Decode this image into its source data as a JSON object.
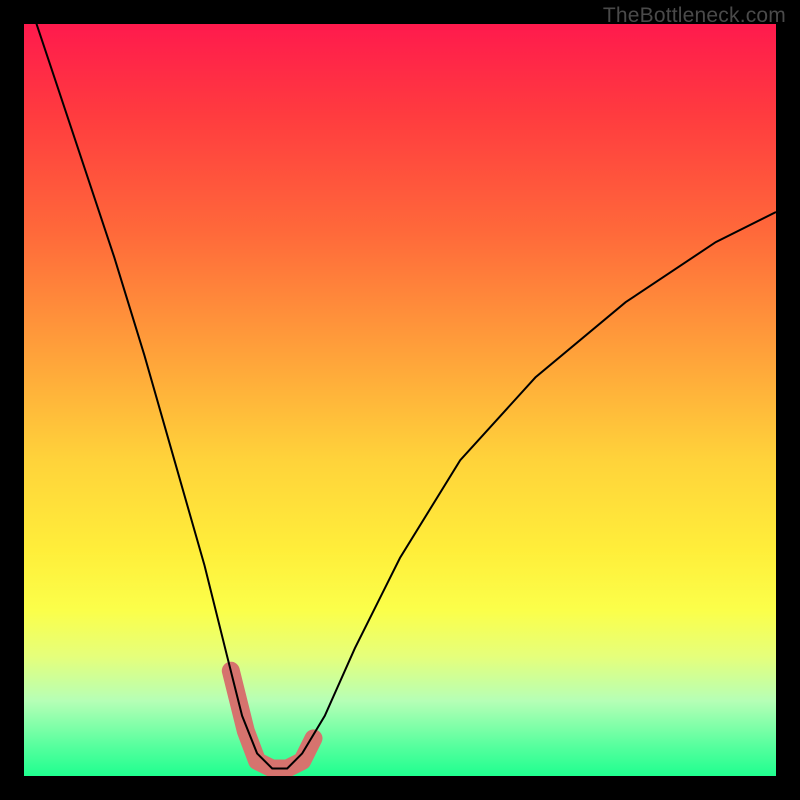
{
  "watermark": "TheBottleneck.com",
  "colors": {
    "page_bg": "#000000",
    "gradient": [
      "#ff1a4d",
      "#ff3b3f",
      "#ff6a3a",
      "#ffa23a",
      "#ffd33a",
      "#ffee3a",
      "#fbff4a",
      "#e6ff7a",
      "#b6ffb6",
      "#57ff9e",
      "#1fff8f"
    ],
    "curve": "#000000",
    "markers": "#d6736e"
  },
  "chart_data": {
    "type": "line",
    "title": "",
    "xlabel": "",
    "ylabel": "",
    "xlim": [
      0,
      100
    ],
    "ylim": [
      0,
      100
    ],
    "series": [
      {
        "name": "bottleneck-curve",
        "x": [
          0,
          4,
          8,
          12,
          16,
          20,
          24,
          27,
          29,
          31,
          33,
          35,
          37,
          40,
          44,
          50,
          58,
          68,
          80,
          92,
          100
        ],
        "values": [
          105,
          93,
          81,
          69,
          56,
          42,
          28,
          16,
          8,
          3,
          1,
          1,
          3,
          8,
          17,
          29,
          42,
          53,
          63,
          71,
          75
        ]
      }
    ],
    "markers": {
      "name": "highlight-band",
      "x": [
        27.5,
        29.5,
        31,
        33,
        35,
        37,
        38.5
      ],
      "values": [
        14,
        6,
        2,
        1,
        1,
        2,
        5
      ]
    }
  }
}
